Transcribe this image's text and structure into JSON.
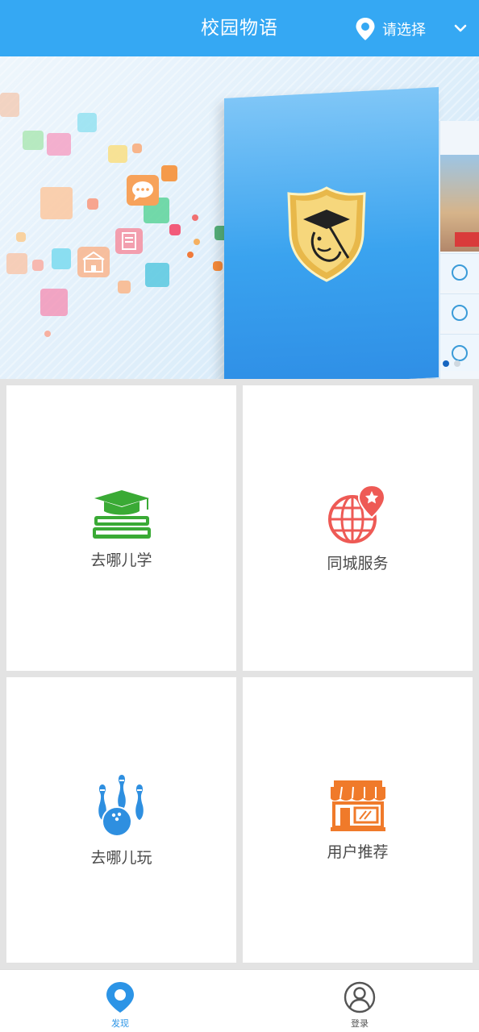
{
  "header": {
    "title": "校园物语",
    "location_label": "请选择"
  },
  "banner": {
    "slide_count": 2,
    "active_slide": 1
  },
  "tiles": [
    {
      "label": "去哪儿学",
      "icon": "graduation-books-icon",
      "color": "#3aaa35"
    },
    {
      "label": "同城服务",
      "icon": "globe-pin-icon",
      "color": "#ee5a55"
    },
    {
      "label": "去哪儿玩",
      "icon": "bowling-icon",
      "color": "#2e8fe0"
    },
    {
      "label": "用户推荐",
      "icon": "storefront-icon",
      "color": "#f07a2a"
    }
  ],
  "nav": {
    "items": [
      {
        "label": "发现",
        "icon": "location-pin-icon",
        "active": true
      },
      {
        "label": "登录",
        "icon": "user-icon",
        "active": false
      }
    ]
  },
  "colors": {
    "primary": "#35a8f3",
    "nav_active": "#2c94e6"
  }
}
